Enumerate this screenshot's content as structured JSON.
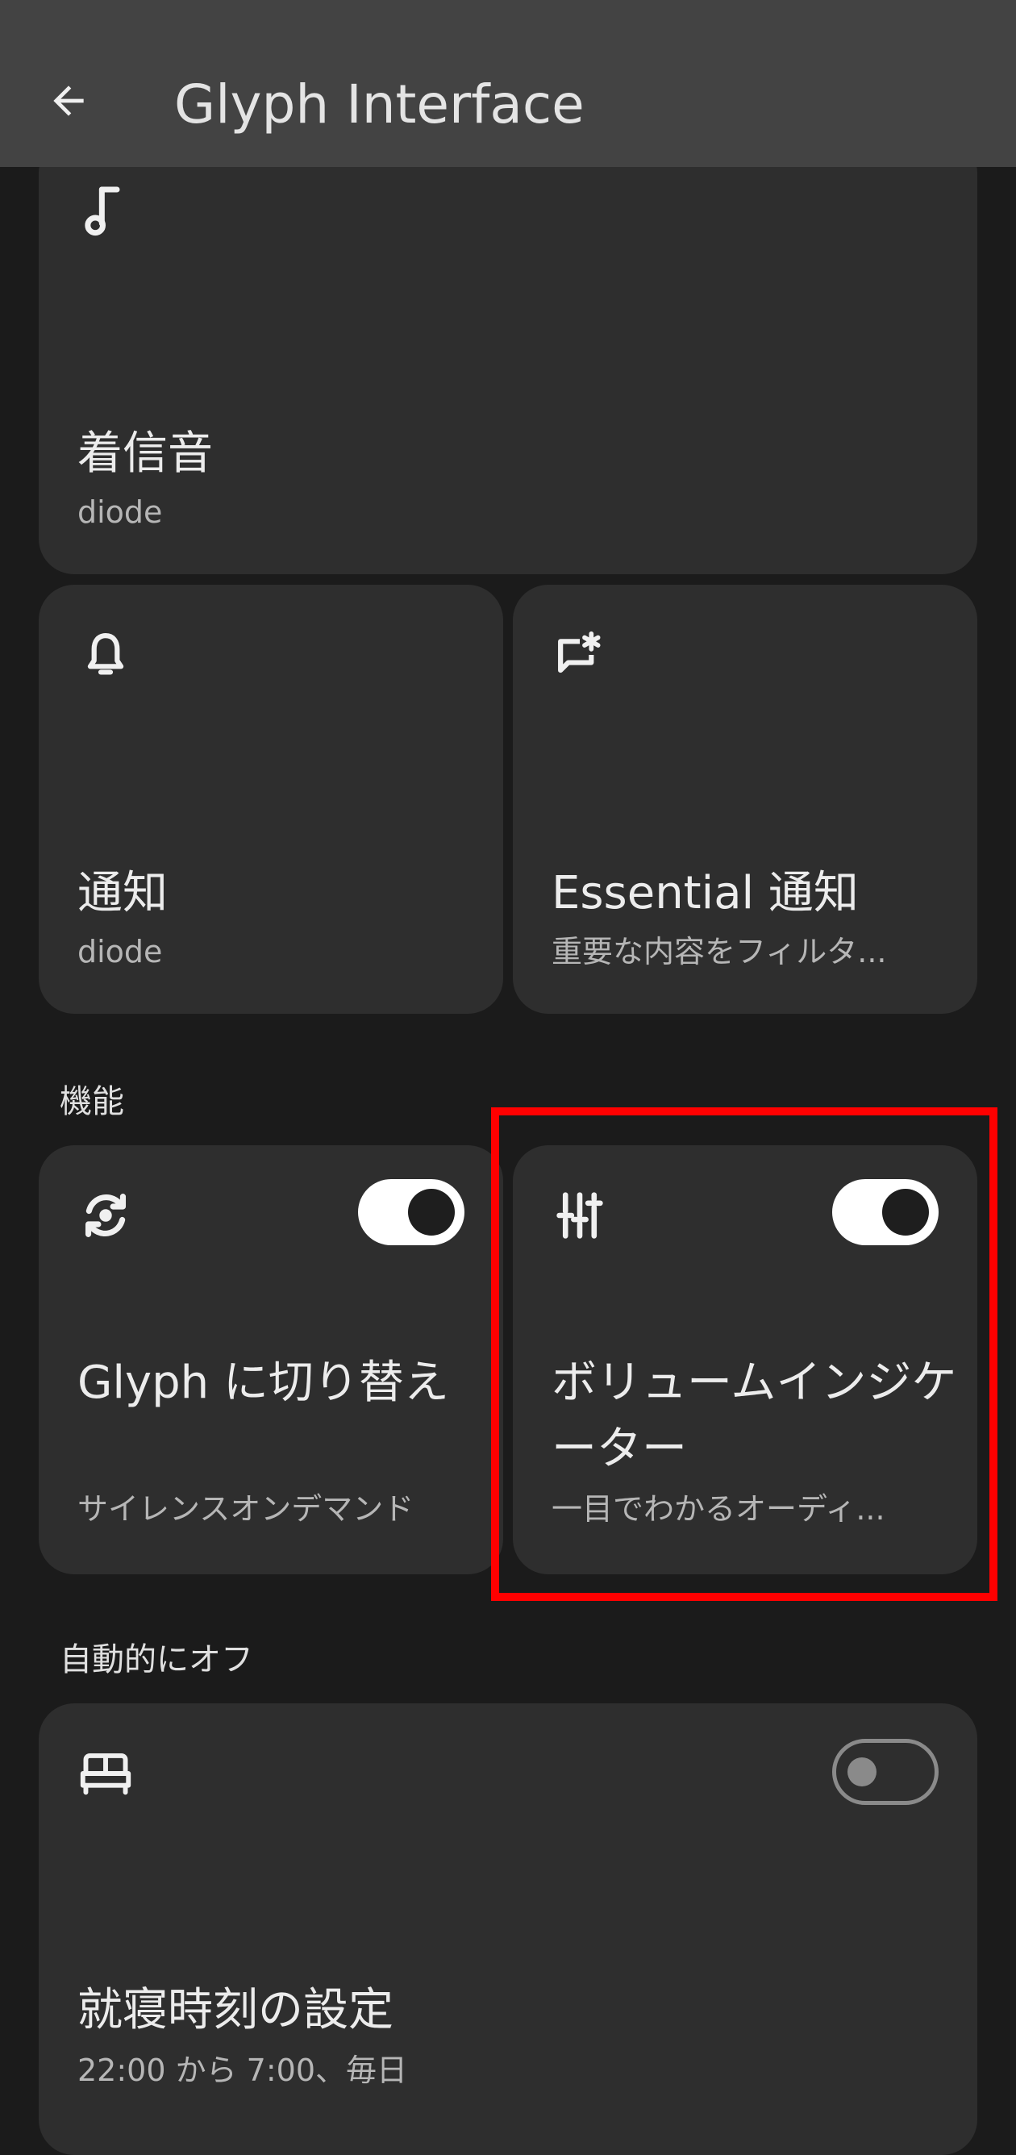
{
  "header": {
    "title": "Glyph Interface"
  },
  "cards": {
    "ringtone": {
      "title": "着信音",
      "subtitle": "diode"
    },
    "notification": {
      "title": "通知",
      "subtitle": "diode"
    },
    "essential": {
      "title": "Essential 通知",
      "subtitle": "重要な内容をフィルタ..."
    },
    "glyph_toggle": {
      "title": "Glyph に切り替え",
      "subtitle": "サイレンスオンデマンド",
      "enabled": true
    },
    "volume_indicator": {
      "title": "ボリュームインジケーター",
      "subtitle": "一目でわかるオーディ...",
      "enabled": true
    },
    "bedtime": {
      "title": "就寝時刻の設定",
      "subtitle": "22:00 から 7:00、毎日",
      "enabled": false
    }
  },
  "sections": {
    "features": "機能",
    "auto_off": "自動的にオフ"
  },
  "colors": {
    "background": "#1b1b1b",
    "app_bar": "#434343",
    "card": "#2e2e2e",
    "highlight": "#ff0000"
  }
}
